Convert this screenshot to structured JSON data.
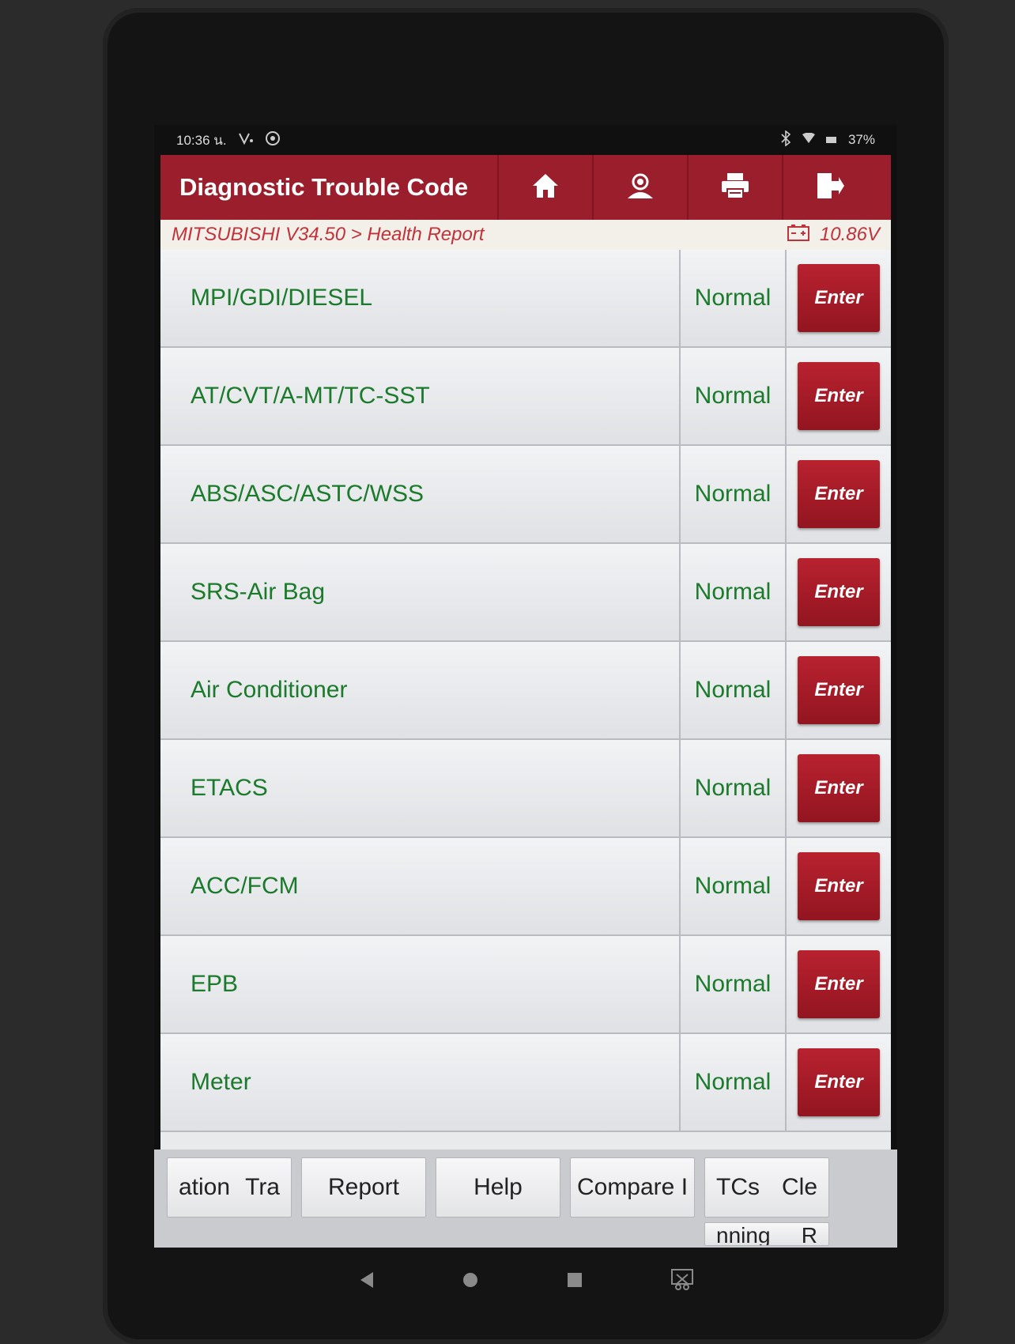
{
  "status_bar": {
    "time": "10:36 น.",
    "battery": "37%"
  },
  "header": {
    "title": "Diagnostic Trouble Code",
    "icons": [
      "home-icon",
      "profile-icon",
      "print-icon",
      "exit-icon"
    ]
  },
  "breadcrumb": {
    "path": "MITSUBISHI V34.50 > Health Report",
    "voltage": "10.86V"
  },
  "systems": [
    {
      "name": "MPI/GDI/DIESEL",
      "status": "Normal",
      "action": "Enter"
    },
    {
      "name": "AT/CVT/A-MT/TC-SST",
      "status": "Normal",
      "action": "Enter"
    },
    {
      "name": "ABS/ASC/ASTC/WSS",
      "status": "Normal",
      "action": "Enter"
    },
    {
      "name": "SRS-Air Bag",
      "status": "Normal",
      "action": "Enter"
    },
    {
      "name": "Air Conditioner",
      "status": "Normal",
      "action": "Enter"
    },
    {
      "name": "ETACS",
      "status": "Normal",
      "action": "Enter"
    },
    {
      "name": "ACC/FCM",
      "status": "Normal",
      "action": "Enter"
    },
    {
      "name": "EPB",
      "status": "Normal",
      "action": "Enter"
    },
    {
      "name": "Meter",
      "status": "Normal",
      "action": "Enter"
    }
  ],
  "toolbar": {
    "btn1_a": "ation",
    "btn1_b": "Tra",
    "report": "Report",
    "help": "Help",
    "compare": "Compare I",
    "btn5_a": "TCs",
    "btn5_b": "Cle",
    "btn6_a": "nning",
    "btn6_b": "R"
  },
  "colors": {
    "header": "#9a1e2b",
    "breadcrumb_text": "#c2323a",
    "row_text": "#1b7a2c",
    "enter_button": "#b8222f"
  }
}
